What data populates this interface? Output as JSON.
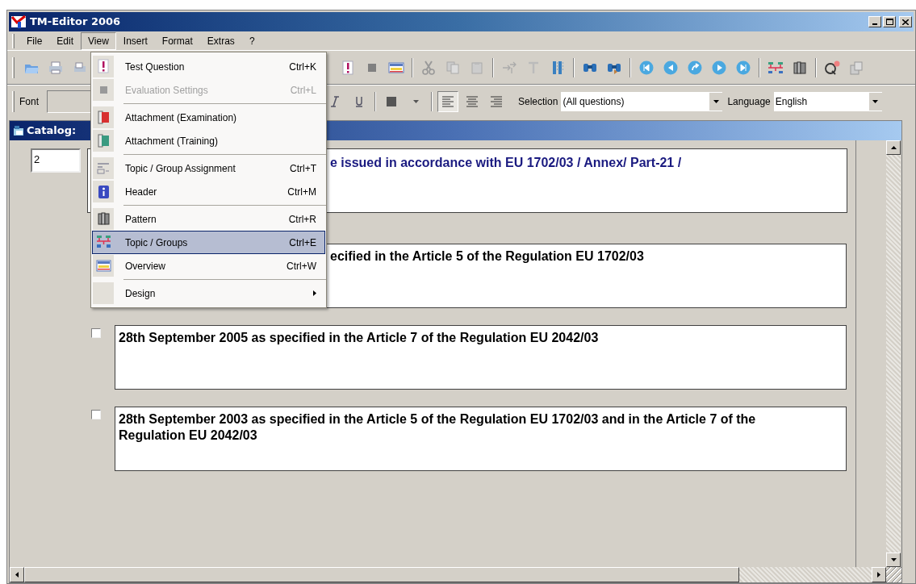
{
  "window": {
    "title": "TM-Editor 2006"
  },
  "menu_bar": [
    {
      "label": "File",
      "selected": false
    },
    {
      "label": "Edit",
      "selected": false
    },
    {
      "label": "View",
      "selected": true
    },
    {
      "label": "Insert",
      "selected": false
    },
    {
      "label": "Format",
      "selected": false
    },
    {
      "label": "Extras",
      "selected": false
    },
    {
      "label": "?",
      "selected": false
    }
  ],
  "view_menu": [
    {
      "kind": "item",
      "label": "Test Question",
      "shortcut": "Ctrl+K",
      "disabled": false,
      "selected": false
    },
    {
      "kind": "item",
      "label": "Evaluation Settings",
      "shortcut": "Ctrl+L",
      "disabled": true,
      "selected": false
    },
    {
      "kind": "separator"
    },
    {
      "kind": "item",
      "label": "Attachment (Examination)",
      "disabled": false,
      "selected": false
    },
    {
      "kind": "item",
      "label": "Attachment (Training)",
      "disabled": false,
      "selected": false
    },
    {
      "kind": "separator"
    },
    {
      "kind": "item",
      "label": "Topic / Group Assignment",
      "shortcut": "Ctrl+T",
      "disabled": false,
      "selected": false
    },
    {
      "kind": "item",
      "label": "Header",
      "shortcut": "Ctrl+M",
      "disabled": false,
      "selected": false
    },
    {
      "kind": "separator"
    },
    {
      "kind": "item",
      "label": "Pattern",
      "shortcut": "Ctrl+R",
      "disabled": false,
      "selected": false
    },
    {
      "kind": "item",
      "label": "Topic / Groups",
      "shortcut": "Ctrl+E",
      "disabled": false,
      "selected": true
    },
    {
      "kind": "item",
      "label": "Overview",
      "shortcut": "Ctrl+W",
      "disabled": false,
      "selected": false
    },
    {
      "kind": "separator"
    },
    {
      "kind": "submenu",
      "label": "Design",
      "disabled": false,
      "selected": false
    }
  ],
  "format_toolbar": {
    "font_label": "Font",
    "alignment_buttons": [
      {
        "selected": true
      },
      {
        "selected": false
      },
      {
        "selected": false
      }
    ],
    "selection_label": "Selection",
    "selection_value": "(All questions)",
    "language_label": "Language",
    "language_value": "English"
  },
  "catalog_window": {
    "title": "Catalog:",
    "question": {
      "number": "2",
      "text": "e issued in accordance with EU 1702/03 / Annex/ Part-21 /"
    },
    "answers": [
      {
        "text": "ecified in the Article 5 of the Regulation EU 1702/03"
      },
      {
        "checked": false,
        "text": "28th September 2005 as specified in the Article 7 of the Regulation EU 2042/03"
      },
      {
        "checked": false,
        "text": "28th September 2003 as specified in the Article 5 of the Regulation EU 1702/03 and in the Article 7 of the Regulation EU 2042/03"
      }
    ]
  }
}
